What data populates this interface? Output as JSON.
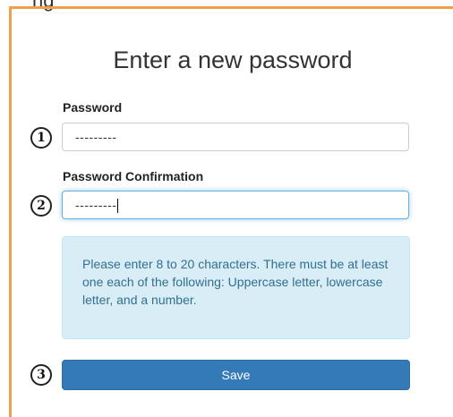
{
  "page": {
    "clipped_top_text": "ng",
    "heading": "Enter a new password"
  },
  "form": {
    "password": {
      "label": "Password",
      "value": "---------",
      "badge": "1"
    },
    "confirmation": {
      "label": "Password Confirmation",
      "value": "---------",
      "badge": "2"
    },
    "help_text": "Please enter 8 to 20 characters. There must be at least one each of the following: Uppercase letter, lowercase letter, and a number.",
    "save": {
      "label": "Save",
      "badge": "3"
    }
  },
  "colors": {
    "accent_border": "#f0a04b",
    "primary_button": "#337ab7",
    "info_background": "#d9edf7",
    "info_text": "#31708f",
    "focus_border": "#66afe9"
  }
}
